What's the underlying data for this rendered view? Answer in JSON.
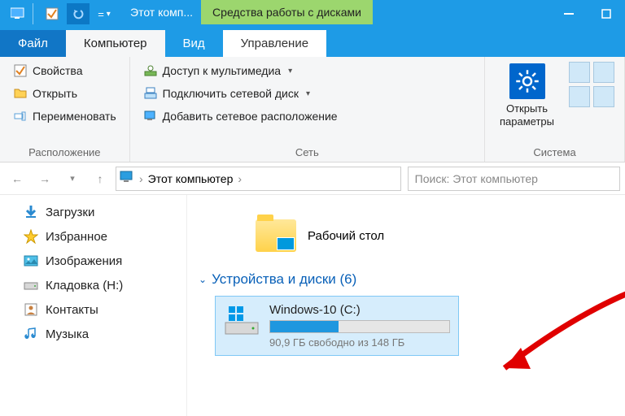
{
  "titlebar": {
    "window_title": "Этот комп...",
    "tools_tab": "Средства работы с дисками"
  },
  "tabs": {
    "file": "Файл",
    "computer": "Компьютер",
    "view": "Вид",
    "manage": "Управление"
  },
  "ribbon": {
    "location": {
      "properties": "Свойства",
      "open": "Открыть",
      "rename": "Переименовать",
      "group": "Расположение"
    },
    "network": {
      "media": "Доступ к мультимедиа",
      "netdrive": "Подключить сетевой диск",
      "netloc": "Добавить сетевое расположение",
      "group": "Сеть"
    },
    "system": {
      "open_settings": "Открыть\nпараметры",
      "group": "Система"
    }
  },
  "address": {
    "crumb": "Этот компьютер"
  },
  "search": {
    "placeholder": "Поиск: Этот компьютер"
  },
  "sidebar": {
    "downloads": "Загрузки",
    "favorites": "Избранное",
    "pictures": "Изображения",
    "kladovka": "Кладовка (H:)",
    "contacts": "Контакты",
    "music": "Музыка"
  },
  "main": {
    "desktop": "Рабочий стол",
    "devices_header": "Устройства и диски (6)",
    "drive_name": "Windows-10 (C:)",
    "drive_free": "90,9 ГБ свободно из 148 ГБ"
  }
}
